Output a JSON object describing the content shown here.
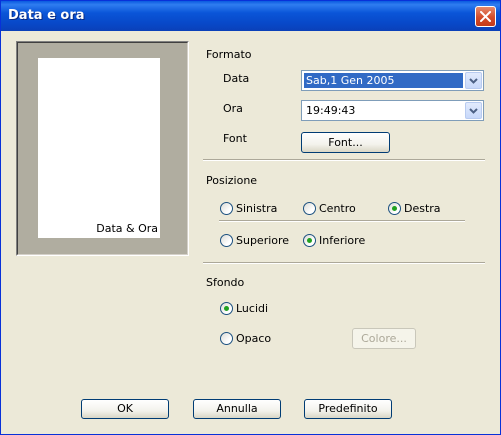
{
  "window": {
    "title": "Data e ora"
  },
  "preview": {
    "label": "Data & Ora"
  },
  "format": {
    "heading": "Formato",
    "date_label": "Data",
    "date_value": "Sab,1 Gen 2005",
    "time_label": "Ora",
    "time_value": "19:49:43",
    "font_label": "Font",
    "font_button": "Font..."
  },
  "position": {
    "heading": "Posizione",
    "horizontal": [
      {
        "label": "Sinistra",
        "checked": false
      },
      {
        "label": "Centro",
        "checked": false
      },
      {
        "label": "Destra",
        "checked": true
      }
    ],
    "vertical": [
      {
        "label": "Superiore",
        "checked": false
      },
      {
        "label": "Inferiore",
        "checked": true
      }
    ]
  },
  "background": {
    "heading": "Sfondo",
    "options": [
      {
        "label": "Lucidi",
        "checked": true
      },
      {
        "label": "Opaco",
        "checked": false
      }
    ],
    "color_button": "Colore..."
  },
  "footer": {
    "ok": "OK",
    "cancel": "Annulla",
    "default": "Predefinito"
  }
}
